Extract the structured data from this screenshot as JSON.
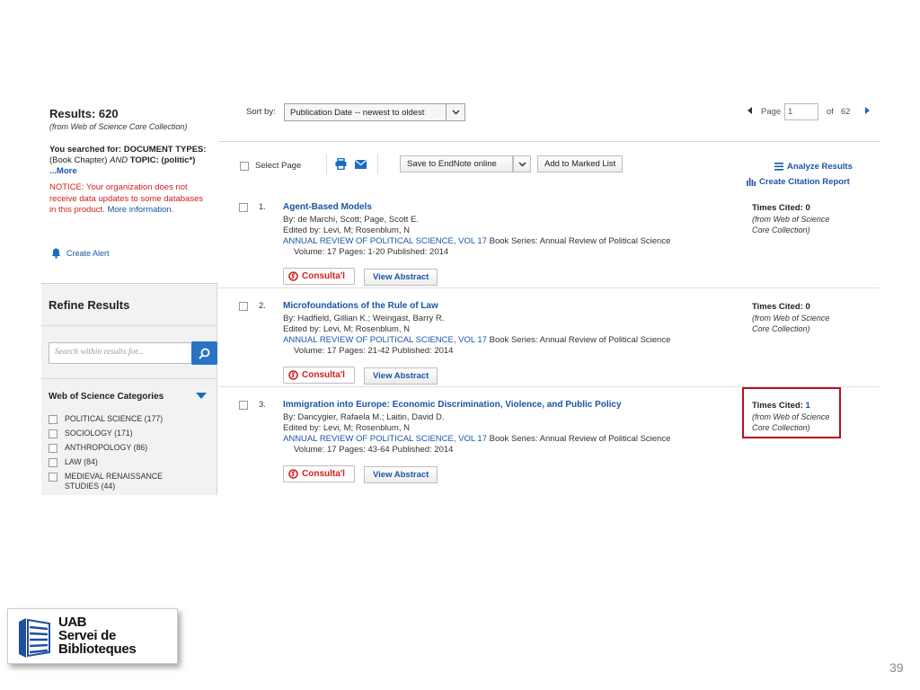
{
  "left_panel": {
    "results_label": "Results: 620",
    "results_source": "(from Web of Science Core Collection)",
    "searched_prefix": "You searched for:",
    "searched_query_1": " DOCUMENT TYPES:",
    "searched_query_2": " (Book Chapter) ",
    "searched_and": "AND",
    "searched_query_3": " TOPIC: (politic*) ",
    "more_link": "...More",
    "notice_text": "NOTICE: Your organization does not receive data updates to some databases in this product.",
    "notice_link": "More information.",
    "create_alert": "Create Alert",
    "refine_title": "Refine Results",
    "search_placeholder": "Search within results for...",
    "categories_title": "Web of Science Categories",
    "categories": [
      "POLITICAL SCIENCE (177)",
      "SOCIOLOGY (171)",
      "ANTHROPOLOGY (86)",
      "LAW (84)",
      "MEDIEVAL RENAISSANCE STUDIES (44)"
    ]
  },
  "header": {
    "sort_label": "Sort by:",
    "sort_value": "Publication Date -- newest to oldest",
    "page_label": "Page",
    "page_value": "1",
    "page_of": "of",
    "page_total": "62"
  },
  "toolbar": {
    "select_page": "Select Page",
    "save_endnote": "Save to EndNote online",
    "add_marked": "Add to Marked List",
    "analyze": "Analyze Results",
    "citation_report": "Create Citation Report"
  },
  "records": [
    {
      "num": "1.",
      "title": "Agent-Based Models",
      "authors": "By: de Marchi, Scott; Page, Scott E.",
      "edited": "Edited by: Levi, M; Rosenblum, N",
      "source": "ANNUAL REVIEW OF POLITICAL SCIENCE, VOL 17",
      "series": "  Book Series: Annual Review of Political Science",
      "details": "Volume: 17   Pages: 1-20   Published: 2014",
      "consulta": "Consulta'l",
      "view_abstract": "View Abstract",
      "cited_label": "Times Cited: 0",
      "cited_src": "(from Web of Science Core Collection)"
    },
    {
      "num": "2.",
      "title": "Microfoundations of the Rule of Law",
      "authors": "By: Hadfield, Gillian K.; Weingast, Barry R.",
      "edited": "Edited by: Levi, M; Rosenblum, N",
      "source": "ANNUAL REVIEW OF POLITICAL SCIENCE, VOL 17",
      "series": "  Book Series: Annual Review of Political Science",
      "details": "Volume: 17   Pages: 21-42   Published: 2014",
      "consulta": "Consulta'l",
      "view_abstract": "View Abstract",
      "cited_label": "Times Cited: 0",
      "cited_src": "(from Web of Science Core Collection)"
    },
    {
      "num": "3.",
      "title": "Immigration into Europe: Economic Discrimination, Violence, and Public Policy",
      "authors": "By: Dancygier, Rafaela M.; Laitin, David D.",
      "edited": "Edited by: Levi, M; Rosenblum, N",
      "source": "ANNUAL REVIEW OF POLITICAL SCIENCE, VOL 17",
      "series": "  Book Series: Annual Review of Political Science",
      "details": "Volume: 17   Pages: 43-64   Published: 2014",
      "consulta": "Consulta'l",
      "view_abstract": "View Abstract",
      "cited_label": "Times Cited: ",
      "cited_count": "1",
      "cited_src": "(from Web of Science Core Collection)"
    }
  ],
  "logo": {
    "line1": "UAB",
    "line2": "Servei de",
    "line3": "Biblioteques"
  },
  "slide_number": "39",
  "colors": {
    "link_blue": "#1a55a6",
    "notice_red": "#d0201a",
    "highlight_red": "#b5121b",
    "search_button_blue": "#2a73c3"
  }
}
